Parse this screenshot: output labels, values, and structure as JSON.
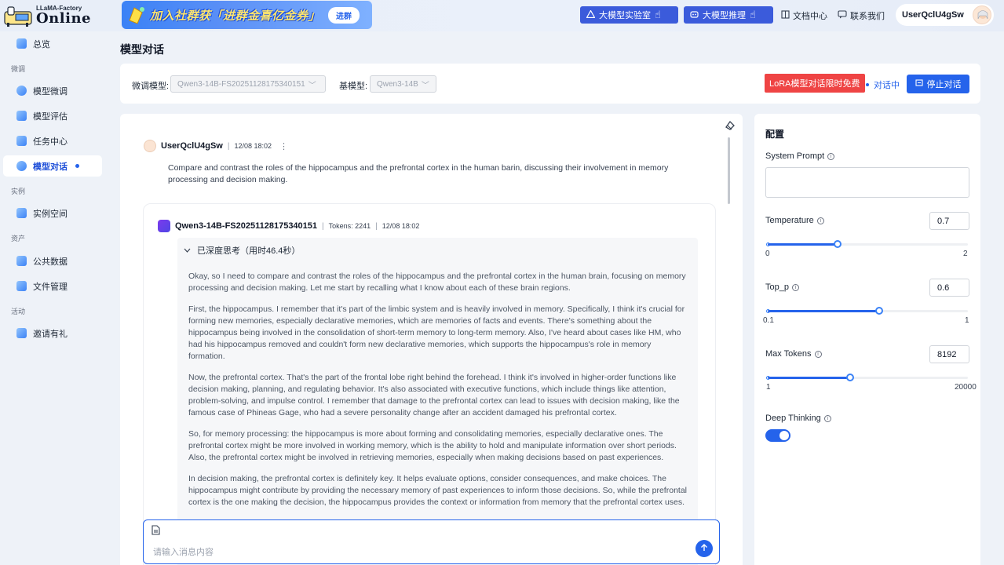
{
  "header": {
    "logo_small": "LLaMA-Factory",
    "logo_big": "Online",
    "banner_text": "加入社群获「进群金喜亿金券」",
    "banner_button": "进群",
    "lab_button": "大模型实验室",
    "infer_button": "大模型推理",
    "docs_link": "文档中心",
    "contact_link": "联系我们",
    "username": "UserQclU4gSw"
  },
  "sidebar": {
    "items": [
      {
        "label": "总览"
      },
      {
        "label": "模型微调"
      },
      {
        "label": "模型评估"
      },
      {
        "label": "任务中心"
      },
      {
        "label": "模型对话"
      },
      {
        "label": "实例空间"
      },
      {
        "label": "公共数据"
      },
      {
        "label": "文件管理"
      },
      {
        "label": "邀请有礼"
      }
    ],
    "sections": {
      "finetune": "微调",
      "instance": "实例",
      "assets": "资产",
      "activity": "活动"
    }
  },
  "page": {
    "title": "模型对话"
  },
  "toolbar": {
    "finetune_label": "微调模型:",
    "finetune_value": "Qwen3-14B-FS20251128175340151",
    "base_label": "基模型:",
    "base_value": "Qwen3-14B",
    "lora_badge": "LoRA模型对话限时免费",
    "status": "对话中",
    "stop_button": "停止对话"
  },
  "chat": {
    "user": {
      "name": "UserQclU4gSw",
      "time": "12/08 18:02",
      "text": "Compare and contrast the roles of the hippocampus and the prefrontal cortex in the human barin, discussing their involvement in memory processing and decision making."
    },
    "ai": {
      "model": "Qwen3-14B-FS20251128175340151",
      "tokens": "Tokens: 2241",
      "time": "12/08 18:02",
      "think_header": "已深度思考（用时46.4秒）",
      "paragraphs": [
        "Okay, so I need to compare and contrast the roles of the hippocampus and the prefrontal cortex in the human brain, focusing on memory processing and decision making. Let me start by recalling what I know about each of these brain regions.",
        "First, the hippocampus. I remember that it's part of the limbic system and is heavily involved in memory. Specifically, I think it's crucial for forming new memories, especially declarative memories, which are memories of facts and events. There's something about the hippocampus being involved in the consolidation of short-term memory to long-term memory. Also, I've heard about cases like HM, who had his hippocampus removed and couldn't form new declarative memories, which supports the hippocampus's role in memory formation.",
        "Now, the prefrontal cortex. That's the part of the frontal lobe right behind the forehead. I think it's involved in higher-order functions like decision making, planning, and regulating behavior. It's also associated with executive functions, which include things like attention, problem-solving, and impulse control. I remember that damage to the prefrontal cortex can lead to issues with decision making, like the famous case of Phineas Gage, who had a severe personality change after an accident damaged his prefrontal cortex.",
        "So, for memory processing: the hippocampus is more about forming and consolidating memories, especially declarative ones. The prefrontal cortex might be more involved in working memory, which is the ability to hold and manipulate information over short periods. Also, the prefrontal cortex might be involved in retrieving memories, especially when making decisions based on past experiences.",
        "In decision making, the prefrontal cortex is definitely key. It helps evaluate options, consider consequences, and make choices. The hippocampus might contribute by providing the necessary memory of past experiences to inform those decisions. So, while the prefrontal cortex is the one making the decision, the hippocampus provides the context or information from memory that the prefrontal cortex uses."
      ]
    },
    "input_placeholder": "请输入消息内容"
  },
  "config": {
    "title": "配置",
    "system_prompt_label": "System Prompt",
    "temperature": {
      "label": "Temperature",
      "value": "0.7",
      "min": "0",
      "max": "2",
      "fraction": 0.35
    },
    "top_p": {
      "label": "Top_p",
      "value": "0.6",
      "min": "0.1",
      "max": "1",
      "fraction": 0.556
    },
    "max_tokens": {
      "label": "Max Tokens",
      "value": "8192",
      "min": "1",
      "max": "20000",
      "fraction": 0.41
    },
    "deep_thinking": {
      "label": "Deep Thinking",
      "enabled": true
    }
  },
  "colors": {
    "accent": "#2563eb",
    "badge": "#ef4444",
    "background": "#eef2f8"
  }
}
